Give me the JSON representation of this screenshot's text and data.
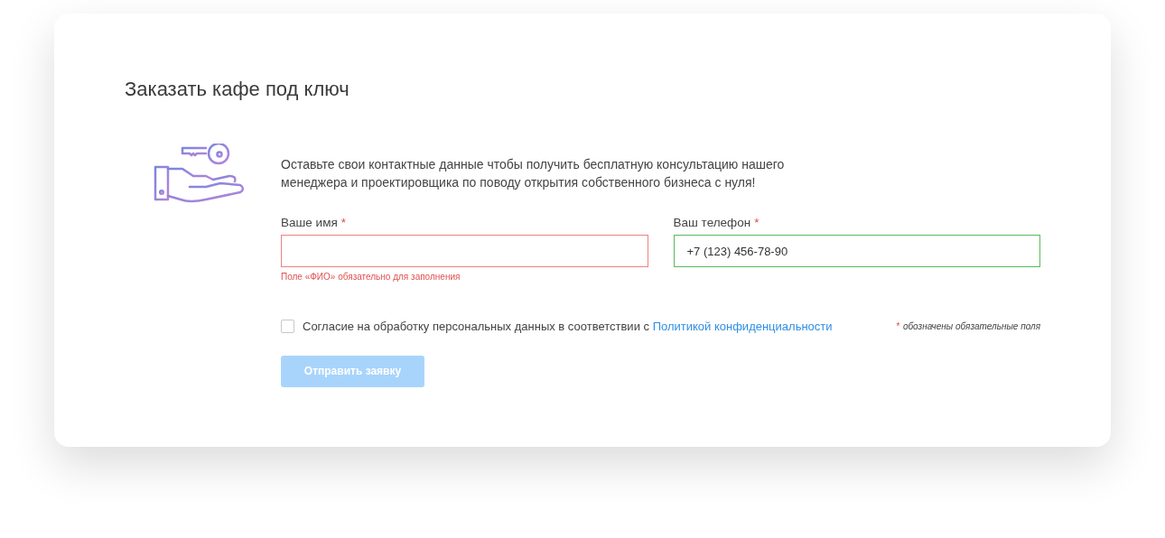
{
  "title": "Заказать кафе под ключ",
  "intro": "Оставьте свои контактные данные чтобы получить бесплатную консультацию нашего менеджера и проектировщика по поводу открытия собственного бизнеса с нуля!",
  "fields": [
    {
      "label": "Ваше имя",
      "required_mark": "*",
      "valid": false,
      "error": "Поле «ФИО» обязательно для заполнения"
    },
    {
      "label": "Ваш телефон",
      "required_mark": "*",
      "value": "+7 (123) 456-78-90",
      "valid": true
    }
  ],
  "consent": {
    "checked": false,
    "text": "Согласие на обработку персональных данных в соответствии с",
    "link": "Политикой конфиденциальности"
  },
  "required_note": {
    "mark": "*",
    "text": "обозначены обязательные поля"
  },
  "submit": {
    "label": "Отправить заявку",
    "disabled": true
  }
}
